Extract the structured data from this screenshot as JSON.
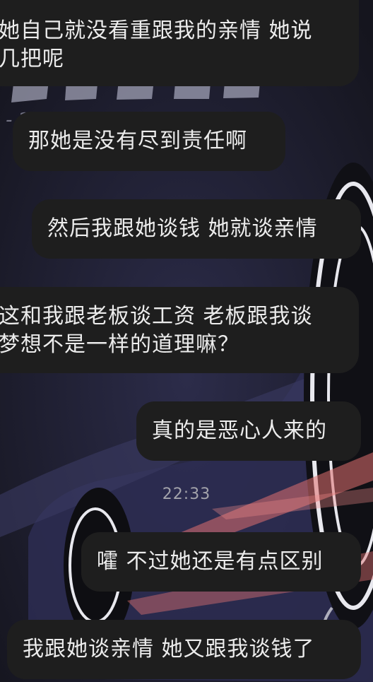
{
  "messages": [
    {
      "lines": [
        "她自己就没看重跟我的亲情 她说",
        "几把呢"
      ],
      "side": "left"
    },
    {
      "lines": [
        "那她是没有尽到责任啊"
      ],
      "side": "left"
    },
    {
      "lines": [
        "然后我跟她谈钱 她就谈亲情"
      ],
      "side": "right"
    },
    {
      "lines": [
        "这和我跟老板谈工资 老板跟我谈",
        "梦想不是一样的道理嘛？"
      ],
      "side": "left"
    },
    {
      "lines": [
        "真的是恶心人来的"
      ],
      "side": "right"
    },
    {
      "lines": [
        "嚯 不过她还是有点区别"
      ],
      "side": "right"
    },
    {
      "lines": [
        "我跟她谈亲情 她又跟我谈钱了"
      ],
      "side": "right"
    }
  ],
  "timestamp": "22:33",
  "colors": {
    "background": "#17171f",
    "bubble": "#1e1e1e",
    "text": "#ececec",
    "timestamp": "#a3a3ab",
    "wallpaper_accent": "#e07070"
  },
  "wallpaper": {
    "description_icon": "race-car-poster-wallpaper"
  }
}
